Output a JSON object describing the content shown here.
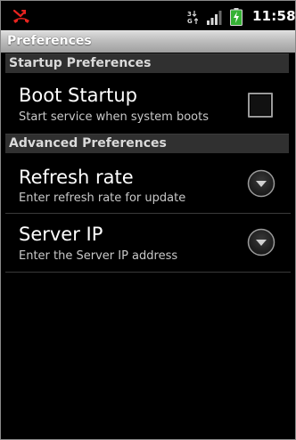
{
  "status_bar": {
    "time": "11:58",
    "network_label": "3G",
    "icons": [
      "missed-call-icon",
      "network-3g-icon",
      "signal-icon",
      "battery-charging-icon"
    ],
    "battery_color": "#35b134"
  },
  "title_bar": {
    "title": "Preferences"
  },
  "categories": [
    {
      "label": "Startup Preferences"
    },
    {
      "label": "Advanced Preferences"
    }
  ],
  "preferences": [
    {
      "title": "Boot Startup",
      "summary": "Start service when system boots",
      "widget": "checkbox",
      "checked": false
    },
    {
      "title": "Refresh rate",
      "summary": "Enter refresh rate for update",
      "widget": "dropdown"
    },
    {
      "title": "Server IP",
      "summary": "Enter the Server IP address",
      "widget": "dropdown"
    }
  ],
  "colors": {
    "background": "#000000",
    "category_background": "#303030",
    "missed_call": "#e8231f"
  }
}
